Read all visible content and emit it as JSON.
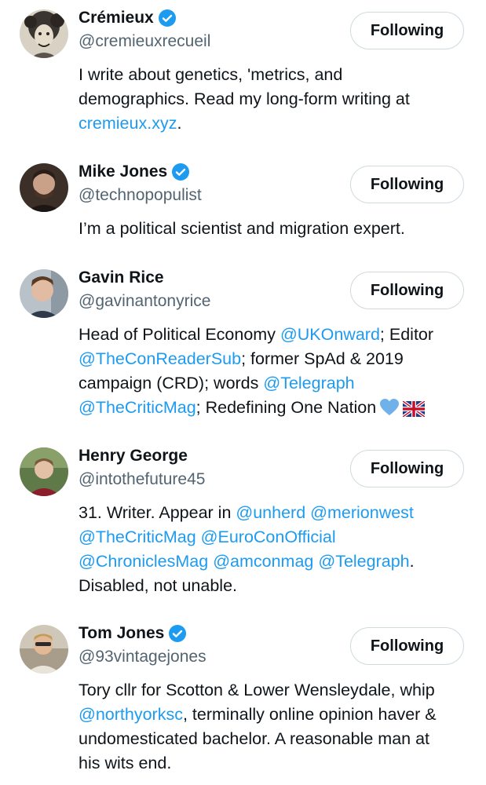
{
  "accounts": [
    {
      "name": "Crémieux",
      "verified": true,
      "handle": "@cremieuxrecueil",
      "button": "Following",
      "bio_lines": [
        [
          {
            "t": "I write about genetics, 'metrics, and"
          }
        ],
        [
          {
            "t": "demographics. Read my long-form writing at"
          }
        ],
        [
          {
            "t": "cremieux.xyz",
            "link": true
          },
          {
            "t": "."
          }
        ]
      ]
    },
    {
      "name": "Mike Jones",
      "verified": true,
      "handle": "@technopopulist",
      "button": "Following",
      "bio_lines": [
        [
          {
            "t": "I’m a political scientist and migration expert."
          }
        ]
      ]
    },
    {
      "name": "Gavin Rice",
      "verified": false,
      "handle": "@gavinantonyrice",
      "button": "Following",
      "bio_lines": [
        [
          {
            "t": "Head of Political Economy "
          },
          {
            "t": "@UKOnward",
            "link": true
          },
          {
            "t": "; Editor"
          }
        ],
        [
          {
            "t": "@TheConReaderSub",
            "link": true
          },
          {
            "t": "; former SpAd & 2019"
          }
        ],
        [
          {
            "t": "campaign (CRD); words "
          },
          {
            "t": "@Telegraph",
            "link": true
          }
        ],
        [
          {
            "t": "@TheCriticMag",
            "link": true
          },
          {
            "t": "; Redefining One Nation"
          },
          {
            "emoji": "blue-heart-icon"
          },
          {
            "emoji": "uk-flag-icon"
          }
        ]
      ]
    },
    {
      "name": "Henry George",
      "verified": false,
      "handle": "@intothefuture45",
      "button": "Following",
      "bio_lines": [
        [
          {
            "t": "31. Writer. Appear in "
          },
          {
            "t": "@unherd",
            "link": true
          },
          {
            "t": " "
          },
          {
            "t": "@merionwest",
            "link": true
          }
        ],
        [
          {
            "t": "@TheCriticMag",
            "link": true
          },
          {
            "t": " "
          },
          {
            "t": "@EuroConOfficial",
            "link": true
          }
        ],
        [
          {
            "t": "@ChroniclesMag",
            "link": true
          },
          {
            "t": " "
          },
          {
            "t": "@amconmag",
            "link": true
          },
          {
            "t": " "
          },
          {
            "t": "@Telegraph",
            "link": true
          },
          {
            "t": "."
          }
        ],
        [
          {
            "t": "Disabled, not unable."
          }
        ]
      ]
    },
    {
      "name": "Tom Jones",
      "verified": true,
      "handle": "@93vintagejones",
      "button": "Following",
      "bio_lines": [
        [
          {
            "t": "Tory cllr for Scotton & Lower Wensleydale, whip"
          }
        ],
        [
          {
            "t": "@northyorksc",
            "link": true
          },
          {
            "t": ", terminally online opinion haver &"
          }
        ],
        [
          {
            "t": "undomesticated bachelor. A reasonable man at"
          }
        ],
        [
          {
            "t": "his wits end."
          }
        ]
      ]
    }
  ],
  "colors": {
    "text": "#0f1419",
    "secondary": "#536471",
    "link": "#1d9bf0",
    "verified": "#1d9bf0",
    "button_border": "#cfd9de"
  }
}
